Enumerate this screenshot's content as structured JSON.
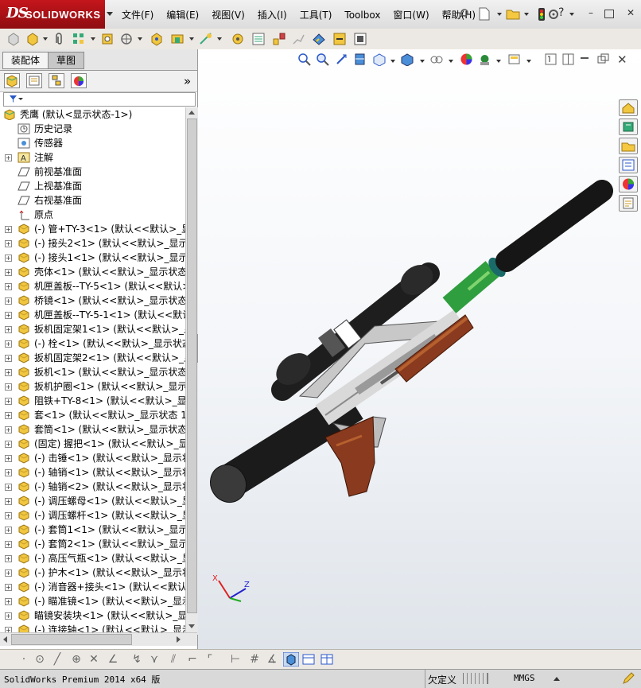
{
  "app": {
    "brand_prefix": "DS",
    "brand_name": "SOLIDWORKS"
  },
  "menu": {
    "items": [
      "文件(F)",
      "编辑(E)",
      "视图(V)",
      "插入(I)",
      "工具(T)",
      "Toolbox",
      "窗口(W)",
      "帮助(H)"
    ]
  },
  "panel": {
    "tabs": [
      "装配体",
      "草图"
    ],
    "active_tab": "草图",
    "collapse_glyph": "»"
  },
  "tree": {
    "root": "秃鹰   (默认<显示状态-1>)",
    "items": [
      {
        "label": "历史记录",
        "icon": "history-icon",
        "plus": false
      },
      {
        "label": "传感器",
        "icon": "sensor-icon",
        "plus": false
      },
      {
        "label": "注解",
        "icon": "annotation-icon",
        "plus": true
      },
      {
        "label": "前视基准面",
        "icon": "plane-icon",
        "plus": false
      },
      {
        "label": "上视基准面",
        "icon": "plane-icon",
        "plus": false
      },
      {
        "label": "右视基准面",
        "icon": "plane-icon",
        "plus": false
      },
      {
        "label": "原点",
        "icon": "origin-icon",
        "plus": false
      },
      {
        "label": "(-) 管+TY-3<1> (默认<<默认>_显示",
        "icon": "part-icon",
        "plus": true
      },
      {
        "label": "(-) 接头2<1> (默认<<默认>_显示状",
        "icon": "part-icon",
        "plus": true
      },
      {
        "label": "(-) 接头1<1> (默认<<默认>_显示状",
        "icon": "part-icon",
        "plus": true
      },
      {
        "label": "壳体<1> (默认<<默认>_显示状态 1>",
        "icon": "part-icon",
        "plus": true
      },
      {
        "label": "机匣盖板--TY-5<1> (默认<<默认>_显",
        "icon": "part-icon",
        "plus": true
      },
      {
        "label": "桥镜<1> (默认<<默认>_显示状态 1>",
        "icon": "part-icon",
        "plus": true
      },
      {
        "label": "机匣盖板--TY-5-1<1> (默认<<默认>",
        "icon": "part-icon",
        "plus": true
      },
      {
        "label": "扳机固定架1<1> (默认<<默认>_显示",
        "icon": "part-icon",
        "plus": true
      },
      {
        "label": "(-) 栓<1> (默认<<默认>_显示状态",
        "icon": "part-icon",
        "plus": true
      },
      {
        "label": "扳机固定架2<1> (默认<<默认>_显示",
        "icon": "part-icon",
        "plus": true
      },
      {
        "label": "扳机<1> (默认<<默认>_显示状态 1>",
        "icon": "part-icon",
        "plus": true
      },
      {
        "label": "扳机护圈<1> (默认<<默认>_显示状",
        "icon": "part-icon",
        "plus": true
      },
      {
        "label": "阻铁+TY-8<1> (默认<<默认>_显示状",
        "icon": "part-icon",
        "plus": true
      },
      {
        "label": "套<1> (默认<<默认>_显示状态 1>)",
        "icon": "part-icon",
        "plus": true
      },
      {
        "label": "套筒<1> (默认<<默认>_显示状态 1>",
        "icon": "part-icon",
        "plus": true
      },
      {
        "label": "(固定) 握把<1> (默认<<默认>_显示",
        "icon": "part-icon",
        "plus": true
      },
      {
        "label": "(-) 击锤<1> (默认<<默认>_显示状",
        "icon": "part-icon",
        "plus": true
      },
      {
        "label": "(-) 轴销<1> (默认<<默认>_显示状",
        "icon": "part-icon",
        "plus": true
      },
      {
        "label": "(-) 轴销<2> (默认<<默认>_显示状",
        "icon": "part-icon",
        "plus": true
      },
      {
        "label": "(-) 调压螺母<1> (默认<<默认>_显示",
        "icon": "part-icon",
        "plus": true
      },
      {
        "label": "(-) 调压螺杆<1> (默认<<默认>_显示",
        "icon": "part-icon",
        "plus": true
      },
      {
        "label": "(-) 套筒1<1> (默认<<默认>_显示状",
        "icon": "part-icon",
        "plus": true
      },
      {
        "label": "(-) 套筒2<1> (默认<<默认>_显示状",
        "icon": "part-icon",
        "plus": true
      },
      {
        "label": "(-) 高压气瓶<1> (默认<<默认>_显示",
        "icon": "part-icon",
        "plus": true
      },
      {
        "label": "(-) 护木<1> (默认<<默认>_显示状",
        "icon": "part-icon",
        "plus": true
      },
      {
        "label": "(-) 消音器+接头<1> (默认<<默认>_",
        "icon": "part-icon",
        "plus": true
      },
      {
        "label": "(-) 瞄准镜<1> (默认<<默认>_显示",
        "icon": "part-icon",
        "plus": true
      },
      {
        "label": "瞄镜安装块<1> (默认<<默认>_显示状",
        "icon": "part-icon",
        "plus": true
      },
      {
        "label": "(-) 连接轴<1> (默认<<默认>_显示",
        "icon": "part-icon",
        "plus": true
      }
    ]
  },
  "triad": {
    "x": "X",
    "z": "Z"
  },
  "status": {
    "product": "SolidWorks Premium 2014 x64 版",
    "definition": "欠定义",
    "units": "MMGS"
  },
  "colors": {
    "brand_red": "#c4161c",
    "viewport_top": "#ffffff",
    "viewport_bottom": "#dfe4ea",
    "wood": "#8a3a1e",
    "green": "#3fb54a",
    "dark_gray": "#2a2a2a"
  }
}
